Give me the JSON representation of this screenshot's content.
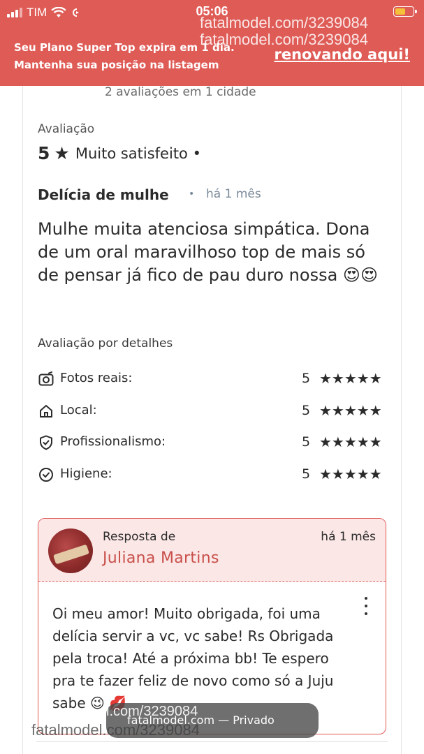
{
  "status_bar": {
    "carrier": "TIM",
    "time": "05:06"
  },
  "banner": {
    "message_line1": "Seu Plano Super Top expira em 1 dia.",
    "message_line2": "Mantenha sua posição na listagem",
    "link": "renovando aqui!"
  },
  "watermarks": {
    "top1": "fatalmodel.com/3239084",
    "top2": "fatalmodel.com/3239084",
    "bottom_pill": "l.com/3239084",
    "bottom_left": "fatalmodel.com/3239084"
  },
  "summary": "2 avaliações em 1 cidade",
  "rating": {
    "label": "Avaliação",
    "value": "5",
    "star": "★",
    "text": "Muito satisfeito •"
  },
  "review": {
    "title": "Delícia de mulhe",
    "separator": "•",
    "date": "há 1 mês",
    "body": "Mulhe muita atenciosa simpática. Dona de um oral maravilhoso top de mais só de pensar já fico de pau duro nossa 😍😍"
  },
  "details": {
    "title": "Avaliação por detalhes",
    "items": [
      {
        "icon": "camera-icon",
        "label": "Fotos reais:",
        "score": "5",
        "stars": "★★★★★"
      },
      {
        "icon": "house-icon",
        "label": "Local:",
        "score": "5",
        "stars": "★★★★★"
      },
      {
        "icon": "shield-check-icon",
        "label": "Profissionalismo:",
        "score": "5",
        "stars": "★★★★★"
      },
      {
        "icon": "check-circle-icon",
        "label": "Higiene:",
        "score": "5",
        "stars": "★★★★★"
      }
    ]
  },
  "reply": {
    "label": "Resposta de",
    "name": "Juliana Martins",
    "date": "há 1 mês",
    "body": "Oi meu amor! Muito obrigada, foi uma delícia servir a vc, vc sabe! Rs Obrigada pela troca! Até a próxima bb! Te espero pra te fazer feliz de novo como só a Juju sabe 😉 💋"
  },
  "bottom_bar": {
    "text": "fatalmodel.com — Privado"
  },
  "colors": {
    "brand": "#df5b56",
    "reply_bg": "#fbe7e6",
    "reply_name": "#c9504b",
    "muted": "#7a8a99"
  }
}
